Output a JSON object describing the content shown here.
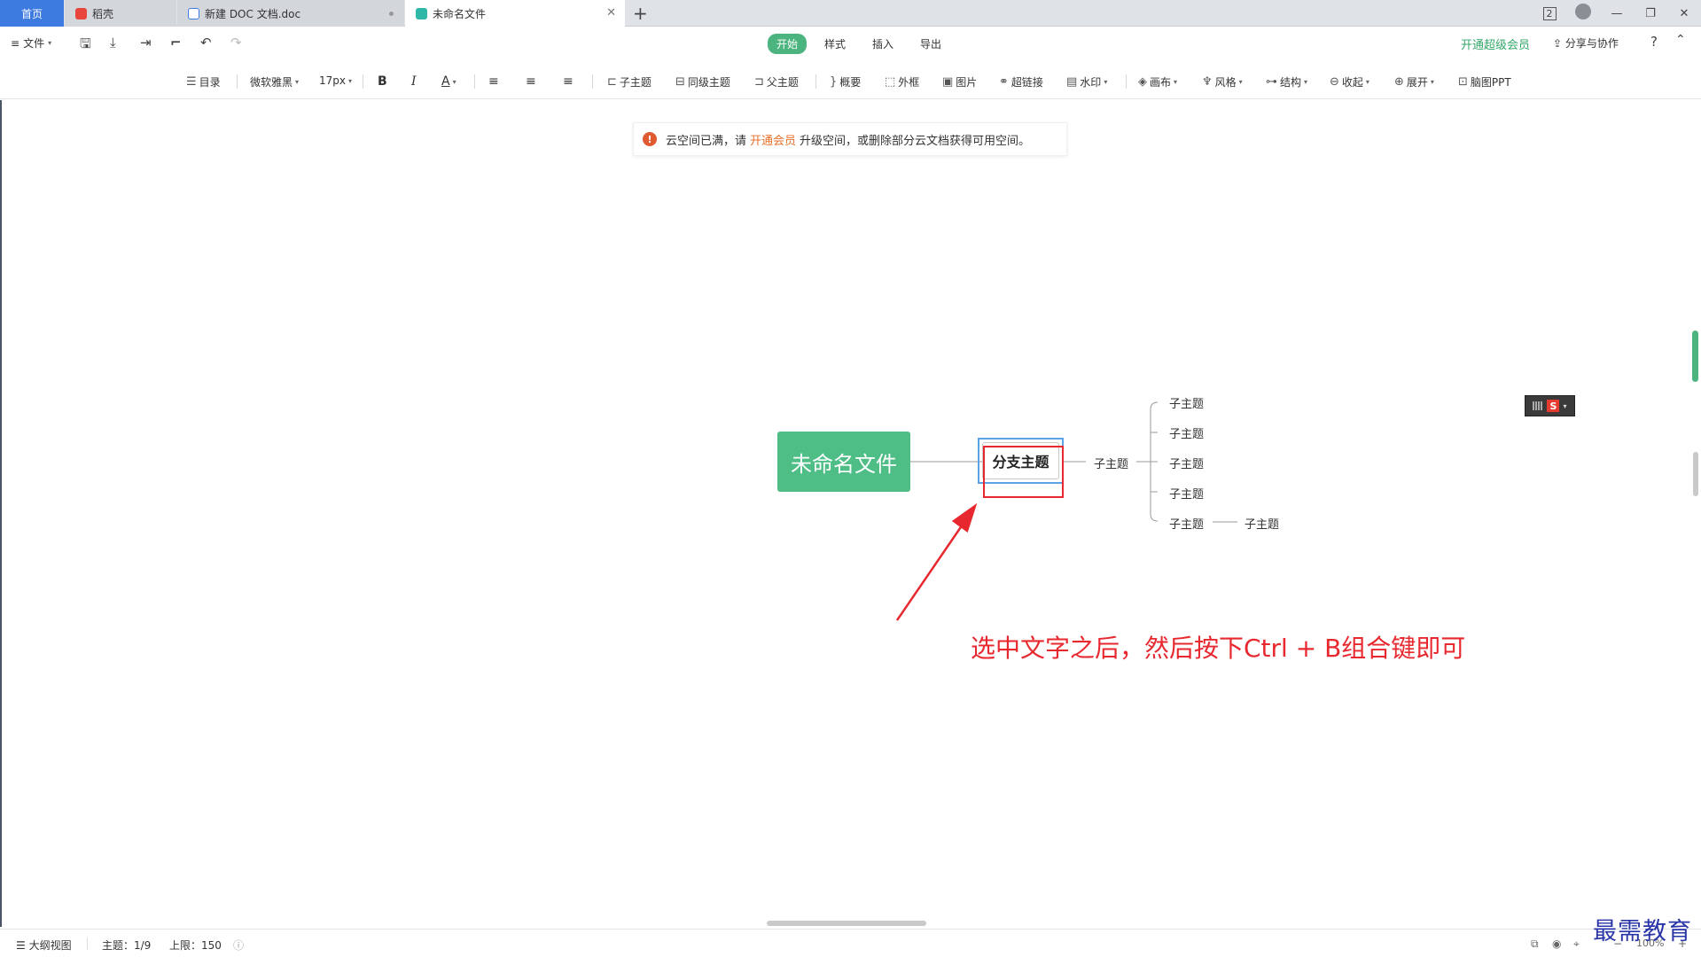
{
  "tabs": {
    "home": "首页",
    "daoke": "稻壳",
    "doc": "新建 DOC 文档.doc",
    "mind": "未命名文件"
  },
  "window": {
    "badge": "2"
  },
  "menubar": {
    "file": "文件",
    "tabs": [
      "开始",
      "样式",
      "插入",
      "导出"
    ],
    "vip": "开通超级会员",
    "share": "分享与协作"
  },
  "toolbar": {
    "toc": "目录",
    "font": "微软雅黑",
    "size": "17px",
    "bold": "B",
    "italic": "I",
    "color": "A",
    "child": "子主题",
    "sibling": "同级主题",
    "parent": "父主题",
    "summary": "概要",
    "frame": "外框",
    "image": "图片",
    "link": "超链接",
    "watermark": "水印",
    "canvas": "画布",
    "style": "风格",
    "structure": "结构",
    "collapse": "收起",
    "expand": "展开",
    "ppt": "脑图PPT"
  },
  "notice": {
    "prefix": "云空间已满，请",
    "link": "开通会员",
    "suffix": "升级空间，或删除部分云文档获得可用空间。"
  },
  "mindmap": {
    "root": "未命名文件",
    "branch": "分支主题",
    "mid": "子主题",
    "subs": [
      "子主题",
      "子主题",
      "子主题",
      "子主题",
      "子主题"
    ],
    "deep": "子主题"
  },
  "annotation": "选中文字之后，然后按下Ctrl + B组合键即可",
  "statusbar": {
    "outline": "大纲视图",
    "topics": "主题：1/9",
    "limit": "上限：150",
    "zoom": "100%"
  },
  "watermark": "最需教育",
  "colors": {
    "accent_green": "#4cb47e",
    "root_green": "#4fbe86",
    "annotation_red": "#e8282f",
    "tab_blue": "#3e7be0"
  }
}
